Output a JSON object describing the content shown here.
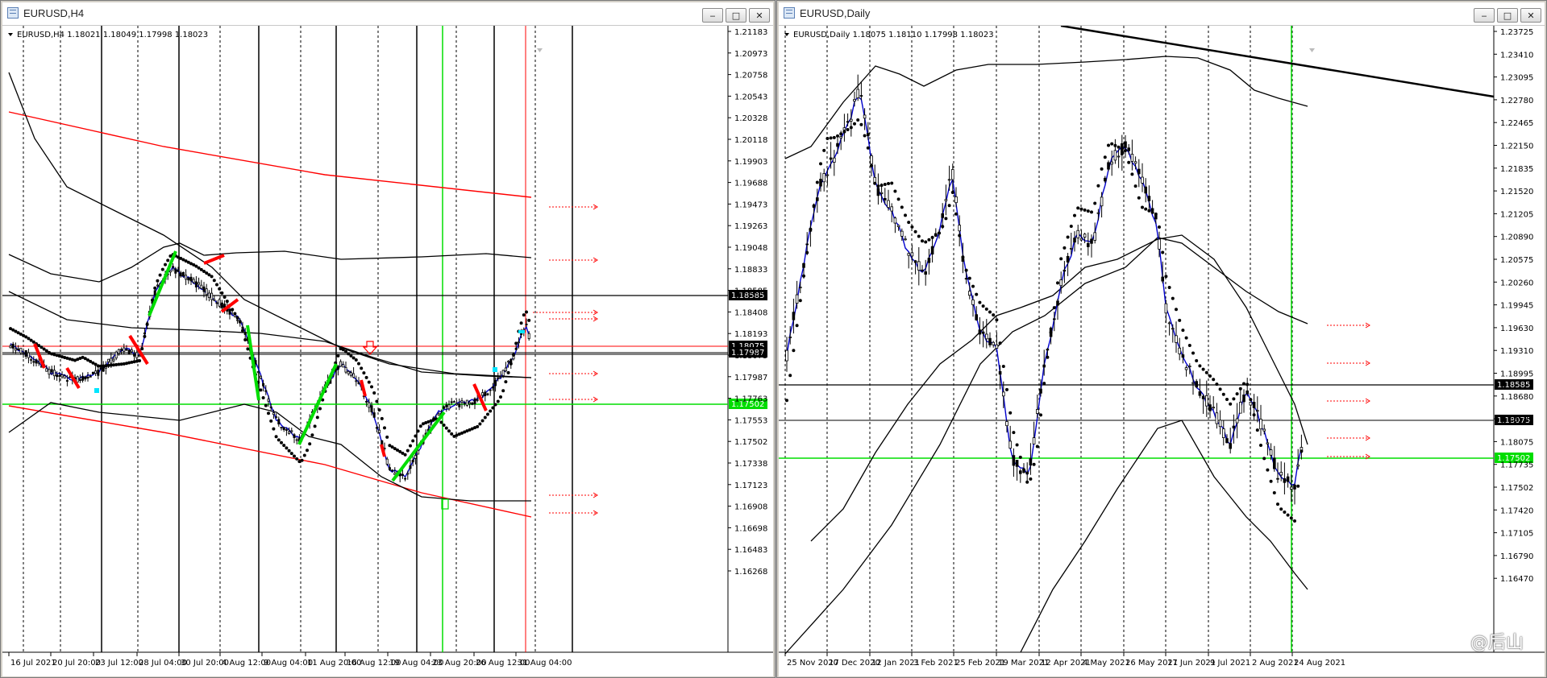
{
  "left_window": {
    "title": "EURUSD,H4",
    "header": "EURUSD,H4  1.18021 1.18049 1.17998 1.18023",
    "buttons": [
      "‒",
      "□",
      "✕"
    ],
    "prices": [
      "1.21183",
      "1.20973",
      "1.20758",
      "1.20543",
      "1.20328",
      "1.20118",
      "1.19903",
      "1.19688",
      "1.19473",
      "1.19263",
      "1.19048",
      "1.18833",
      "1.18585",
      "1.18408",
      "1.18193",
      "1.18075",
      "1.17987",
      "1.17763",
      "1.17553",
      "1.17502",
      "1.17338",
      "1.17123",
      "1.16908",
      "1.16698",
      "1.16483",
      "1.16268"
    ],
    "tags": [
      {
        "text": "1.18585",
        "bg": "#000000",
        "fg": "#ffffff"
      },
      {
        "text": "1.18075",
        "bg": "#000000",
        "fg": "#ffffff"
      },
      {
        "text": "1.17987",
        "bg": "#000000",
        "fg": "#ffffff"
      },
      {
        "text": "1.17502",
        "bg": "#00dd00",
        "fg": "#ffffff"
      }
    ],
    "dates": [
      "16 Jul 2021",
      "20 Jul 20:00",
      "23 Jul 12:00",
      "28 Jul 04:00",
      "30 Jul 20:00",
      "4 Aug 12:00",
      "9 Aug 04:00",
      "11 Aug 20:00",
      "16 Aug 12:00",
      "19 Aug 04:00",
      "23 Aug 20:00",
      "26 Aug 12:00",
      "31 Aug 04:00"
    ]
  },
  "right_window": {
    "title": "EURUSD,Daily",
    "header": "EURUSD,Daily  1.18075 1.18110 1.17998 1.18023",
    "buttons": [
      "‒",
      "□",
      "✕"
    ],
    "prices": [
      "1.23725",
      "1.23410",
      "1.23095",
      "1.22780",
      "1.22465",
      "1.22150",
      "1.21835",
      "1.21520",
      "1.21205",
      "1.20890",
      "1.20575",
      "1.20260",
      "1.19945",
      "1.19630",
      "1.19310",
      "1.18995",
      "1.18680",
      "1.18585",
      "1.18075",
      "1.17735",
      "1.17502",
      "1.17420",
      "1.17105",
      "1.16790",
      "1.16470"
    ],
    "tags": [
      {
        "text": "1.18585",
        "bg": "#000000",
        "fg": "#ffffff"
      },
      {
        "text": "1.18075",
        "bg": "#000000",
        "fg": "#ffffff"
      },
      {
        "text": "1.17502",
        "bg": "#00dd00",
        "fg": "#ffffff"
      }
    ],
    "dates": [
      "25 Nov 2020",
      "17 Dec 2020",
      "12 Jan 2021",
      "3 Feb 2021",
      "25 Feb 2021",
      "19 Mar 2021",
      "12 Apr 2021",
      "4 May 2021",
      "26 May 2021",
      "17 Jun 2021",
      "9 Jul 2021",
      "2 Aug 2021",
      "24 Aug 2021"
    ],
    "watermark": "@后山"
  },
  "colors": {
    "accent_green": "#00dd00",
    "accent_red": "#ff0000",
    "ma_blue": "#0000cc"
  }
}
